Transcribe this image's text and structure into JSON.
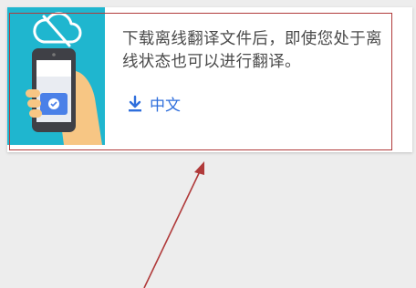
{
  "offline_card": {
    "description": "下载离线翻译文件后，即使您处于离线状态也可以进行翻译。",
    "download_language_label": "中文",
    "illustration_icons": [
      "cloud-offline-icon",
      "phone-icon",
      "translate-badge-icon"
    ],
    "download_icon": "download-arrow-icon"
  },
  "colors": {
    "illustration_bg": "#1fb6cf",
    "link": "#2f6fdc",
    "annotation": "#b03a3a"
  }
}
